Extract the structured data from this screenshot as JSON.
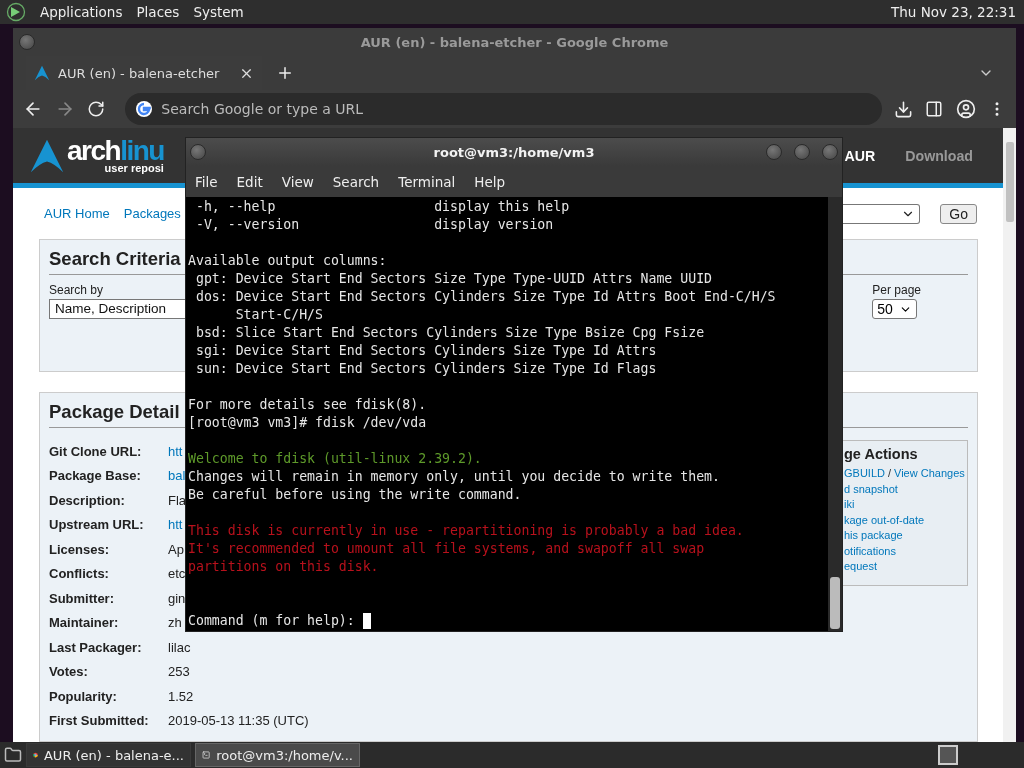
{
  "top_panel": {
    "menus": [
      "Applications",
      "Places",
      "System"
    ],
    "clock": "Thu Nov 23, 22:31"
  },
  "browser": {
    "title": "AUR (en) - balena-etcher - Google Chrome",
    "tabs": [
      {
        "label": "AUR (en) - balena-etcher",
        "selected": true
      }
    ],
    "omnibox": {
      "placeholder": "Search Google or type a URL"
    },
    "page": {
      "logo": {
        "word": "arch",
        "accent": "linu",
        "subtitle": "user reposi"
      },
      "nav": [
        {
          "label": "AUR",
          "selected": true
        },
        {
          "label": "Download",
          "selected": false
        }
      ],
      "breadcrumbs": [
        "AUR Home",
        "Packages"
      ],
      "go_button": "Go",
      "search_criteria": {
        "heading": "Search Criteria",
        "search_by_label": "Search by",
        "search_by_value": "Name, Description",
        "per_page_label": "Per page",
        "per_page_value": "50"
      },
      "package_details": {
        "heading": "Package Detail",
        "rows": [
          {
            "label": "Git Clone URL:",
            "value": "htt",
            "kind": "link"
          },
          {
            "label": "Package Base:",
            "value": "bal",
            "kind": "link"
          },
          {
            "label": "Description:",
            "value": "Fla",
            "kind": "text"
          },
          {
            "label": "Upstream URL:",
            "value": "htt",
            "kind": "link"
          },
          {
            "label": "Licenses:",
            "value": "Ap",
            "kind": "text"
          },
          {
            "label": "Conflicts:",
            "value": "etc",
            "kind": "text"
          },
          {
            "label": "Submitter:",
            "value": "gin",
            "kind": "text"
          },
          {
            "label": "Maintainer:",
            "value": "zh",
            "kind": "text"
          },
          {
            "label": "Last Packager:",
            "value": "lilac",
            "kind": "text"
          },
          {
            "label": "Votes:",
            "value": "253",
            "kind": "text"
          },
          {
            "label": "Popularity:",
            "value": "1.52",
            "kind": "text"
          },
          {
            "label": "First Submitted:",
            "value": "2019-05-13 11:35 (UTC)",
            "kind": "text"
          }
        ]
      },
      "package_actions": {
        "heading": "ge Actions",
        "separator": "/",
        "links": [
          [
            "GBUILD",
            "View Changes"
          ],
          [
            "d snapshot"
          ],
          [
            "iki"
          ],
          [
            "kage out-of-date"
          ],
          [
            "his package"
          ],
          [
            "otifications"
          ],
          [
            "equest"
          ]
        ]
      }
    }
  },
  "terminal": {
    "title": "root@vm3:/home/vm3",
    "menus": [
      "File",
      "Edit",
      "View",
      "Search",
      "Terminal",
      "Help"
    ],
    "blocks": [
      [
        {
          "text": " -h, --help                    display this help",
          "kind": "output"
        },
        {
          "text": " -V, --version                 display version",
          "kind": "output"
        }
      ],
      [
        {
          "text": "Available output columns:",
          "kind": "output"
        },
        {
          "text": " gpt: Device Start End Sectors Size Type Type-UUID Attrs Name UUID",
          "kind": "output"
        },
        {
          "text": " dos: Device Start End Sectors Cylinders Size Type Id Attrs Boot End-C/H/S",
          "kind": "output"
        },
        {
          "text": "      Start-C/H/S",
          "kind": "output"
        },
        {
          "text": " bsd: Slice Start End Sectors Cylinders Size Type Bsize Cpg Fsize",
          "kind": "output"
        },
        {
          "text": " sgi: Device Start End Sectors Cylinders Size Type Id Attrs",
          "kind": "output"
        },
        {
          "text": " sun: Device Start End Sectors Cylinders Size Type Id Flags",
          "kind": "output"
        }
      ],
      [
        {
          "text": "For more details see fdisk(8).",
          "kind": "output"
        },
        {
          "text": "[root@vm3 vm3]# fdisk /dev/vda",
          "kind": "output"
        }
      ],
      [
        {
          "text": "Welcome to fdisk (util-linux 2.39.2).",
          "kind": "info"
        },
        {
          "text": "Changes will remain in memory only, until you decide to write them.",
          "kind": "output"
        },
        {
          "text": "Be careful before using the write command.",
          "kind": "output"
        }
      ],
      [
        {
          "text": "This disk is currently in use - repartitioning is probably a bad idea.",
          "kind": "error"
        },
        {
          "text": "It's recommended to umount all file systems, and swapoff all swap",
          "kind": "error"
        },
        {
          "text": "partitions on this disk.",
          "kind": "error"
        }
      ]
    ],
    "prompt": "Command (m for help): "
  },
  "taskbar": {
    "items": [
      {
        "label": "AUR (en) - balena-e...",
        "kind": "browser",
        "selected": false
      },
      {
        "label": "root@vm3:/home/v...",
        "kind": "terminal",
        "selected": true
      }
    ]
  }
}
